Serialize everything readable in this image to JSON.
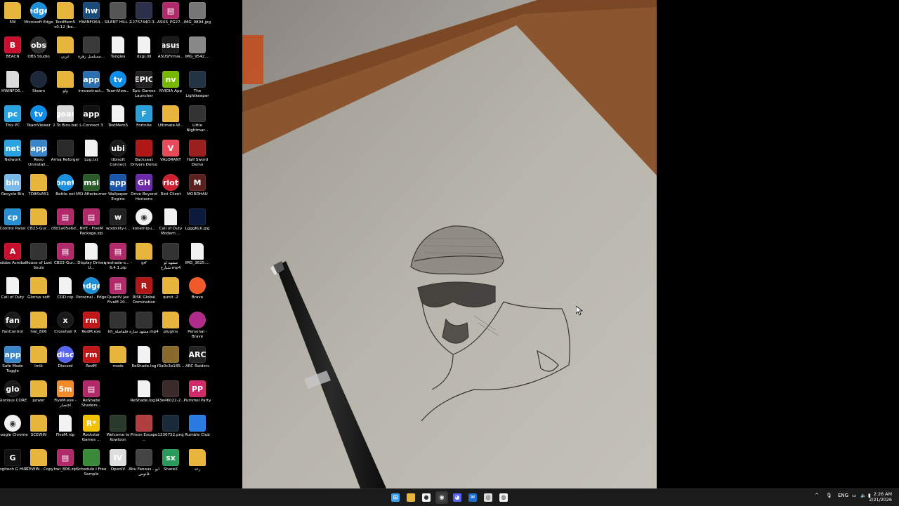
{
  "desktop": {
    "icons": [
      {
        "label": "5W",
        "color": "#e8b53c",
        "glyph": "folder"
      },
      {
        "label": "Microsoft Edge",
        "color": "#1d8fd6",
        "glyph": "edge"
      },
      {
        "label": "TestMem5 v0.12 (be...",
        "color": "#e8b53c",
        "glyph": "folder"
      },
      {
        "label": "HWiNFO64...",
        "color": "#1a4a7a",
        "glyph": "hw"
      },
      {
        "label": "SILENT HILL 2",
        "color": "#555",
        "glyph": "img"
      },
      {
        "label": "1275744D-3...",
        "color": "#2b2f4a",
        "glyph": "img"
      },
      {
        "label": "ASUS_PG27...",
        "color": "#b02a6a",
        "glyph": "rar"
      },
      {
        "label": "IMG_9894.jpg",
        "color": "#777",
        "glyph": "img"
      },
      {
        "label": "BEACN",
        "color": "#c8102e",
        "glyph": "B"
      },
      {
        "label": "OBS Studio",
        "color": "#303030",
        "glyph": "obs"
      },
      {
        "label": "عربي",
        "color": "#e8b53c",
        "glyph": "folder"
      },
      {
        "label": "مسلسل زهرة...",
        "color": "#3a3a3a",
        "glyph": "img"
      },
      {
        "label": "Tangles",
        "color": "#f2f2f2",
        "glyph": "doc"
      },
      {
        "label": "dxgi.dll",
        "color": "#f2f2f2",
        "glyph": "doc"
      },
      {
        "label": "ASUSFirmw...",
        "color": "#1a1a1a",
        "glyph": "asus"
      },
      {
        "label": "IMG_9542....",
        "color": "#888",
        "glyph": "img"
      },
      {
        "label": "HWiNFO6...",
        "color": "#dcdcdc",
        "glyph": "doc"
      },
      {
        "label": "Steam",
        "color": "#1b2838",
        "glyph": "steam"
      },
      {
        "label": "ولو",
        "color": "#e8b53c",
        "glyph": "folder"
      },
      {
        "label": "innoextract...",
        "color": "#2a6fb0",
        "glyph": "app"
      },
      {
        "label": "TeamView...",
        "color": "#0e8ee9",
        "glyph": "tv"
      },
      {
        "label": "Epic Games Launcher",
        "color": "#222",
        "glyph": "EPIC"
      },
      {
        "label": "NVIDIA App",
        "color": "#76b900",
        "glyph": "nv"
      },
      {
        "label": "The Lightkeeper",
        "color": "#234",
        "glyph": "img"
      },
      {
        "label": "This PC",
        "color": "#2aa2e0",
        "glyph": "pc"
      },
      {
        "label": "TeamViewer",
        "color": "#0e8ee9",
        "glyph": "tv"
      },
      {
        "label": "2 To Bios.bat",
        "color": "#d8d8d8",
        "glyph": "gear"
      },
      {
        "label": "L-Connect 3",
        "color": "#111",
        "glyph": "app"
      },
      {
        "label": "TestMem5",
        "color": "#f2f2f2",
        "glyph": "doc"
      },
      {
        "label": "Fortnite",
        "color": "#2a9fd8",
        "glyph": "F"
      },
      {
        "label": "Ultimate-W...",
        "color": "#e8b53c",
        "glyph": "folder"
      },
      {
        "label": "Little Nightmar...",
        "color": "#333",
        "glyph": "img"
      },
      {
        "label": "Network",
        "color": "#2aa2e0",
        "glyph": "net"
      },
      {
        "label": "Revo Uninstall...",
        "color": "#3a86c8",
        "glyph": "app"
      },
      {
        "label": "Arma Reforger",
        "color": "#2a2a2a",
        "glyph": "img"
      },
      {
        "label": "Log.txt",
        "color": "#f2f2f2",
        "glyph": "doc"
      },
      {
        "label": "Ubisoft Connect",
        "color": "#1a1a1a",
        "glyph": "ubi"
      },
      {
        "label": "Backseat Drivers Demo",
        "color": "#b01818",
        "glyph": "img"
      },
      {
        "label": "VALORANT",
        "color": "#e84a5a",
        "glyph": "V"
      },
      {
        "label": "Half Sword Demo",
        "color": "#9a2020",
        "glyph": "img"
      },
      {
        "label": "Recycle Bin",
        "color": "#7ab8e8",
        "glyph": "bin"
      },
      {
        "label": "7D86VA51",
        "color": "#e8b53c",
        "glyph": "folder"
      },
      {
        "label": "Battle.net",
        "color": "#1a8fe0",
        "glyph": "bnet"
      },
      {
        "label": "MSI Afterburner",
        "color": "#2a5a2a",
        "glyph": "msi"
      },
      {
        "label": "Wallpaper Engine",
        "color": "#1a55a8",
        "glyph": "app"
      },
      {
        "label": "Drive Beyond Horizons",
        "color": "#6a2aa8",
        "glyph": "GH"
      },
      {
        "label": "Riot Client",
        "color": "#d02030",
        "glyph": "riot"
      },
      {
        "label": "MORDHAU",
        "color": "#5a2020",
        "glyph": "M"
      },
      {
        "label": "Control Panel",
        "color": "#2a8fd0",
        "glyph": "cp"
      },
      {
        "label": "CB23-Gur...",
        "color": "#e8b53c",
        "glyph": "folder"
      },
      {
        "label": "c8d1a05e6d...",
        "color": "#b02a6a",
        "glyph": "rar"
      },
      {
        "label": "NVE - FiveM Package.zip",
        "color": "#b02a6a",
        "glyph": "rar"
      },
      {
        "label": "woobility-l...",
        "color": "#222",
        "glyph": "w"
      },
      {
        "label": "konemipu...",
        "color": "#f2f2f2",
        "glyph": "chrome"
      },
      {
        "label": "Call of Duty Modern ...",
        "color": "#f2f2f2",
        "glyph": "doc"
      },
      {
        "label": "LgggKLK.jpg",
        "color": "#0b1b3b",
        "glyph": "img"
      },
      {
        "label": "Adobe Acrobat",
        "color": "#c8102e",
        "glyph": "pdf"
      },
      {
        "label": "House of Lost Souls",
        "color": "#333",
        "glyph": "img"
      },
      {
        "label": "CB23-Gur...",
        "color": "#b02a6a",
        "glyph": "rar"
      },
      {
        "label": "Display Driver U...",
        "color": "#f2f2f2",
        "glyph": "doc"
      },
      {
        "label": "qreshade-s... - 6.4.1.zip",
        "color": "#b02a6a",
        "glyph": "rar"
      },
      {
        "label": "grf",
        "color": "#e8b53c",
        "glyph": "folder"
      },
      {
        "label": "مشهد لو شيارح.mp4",
        "color": "#333",
        "glyph": "img"
      },
      {
        "label": "IMG_3625....",
        "color": "#f2f2f2",
        "glyph": "doc"
      },
      {
        "label": "Call of Duty",
        "color": "#f2f2f2",
        "glyph": "doc"
      },
      {
        "label": "Glorius soft",
        "color": "#e8b53c",
        "glyph": "folder"
      },
      {
        "label": "COD.nip",
        "color": "#f2f2f2",
        "glyph": "doc"
      },
      {
        "label": "Personal - Edge",
        "color": "#1d8fd6",
        "glyph": "edge"
      },
      {
        "label": "QuantV jax FiveM 20...",
        "color": "#b02a6a",
        "glyph": "rar"
      },
      {
        "label": "RISK Global Domination",
        "color": "#b01818",
        "glyph": "R"
      },
      {
        "label": "qunit -2",
        "color": "#e8b53c",
        "glyph": "folder"
      },
      {
        "label": "Brave",
        "color": "#f05a28",
        "glyph": "brave"
      },
      {
        "label": "FanControl",
        "color": "#1a1a1a",
        "glyph": "fan"
      },
      {
        "label": "hwi_806",
        "color": "#e8b53c",
        "glyph": "folder"
      },
      {
        "label": "Crosshair X",
        "color": "#1a1a1a",
        "glyph": "x"
      },
      {
        "label": "RedM.exe",
        "color": "#c01818",
        "glyph": "rm"
      },
      {
        "label": "kh_فلفاضلة",
        "color": "#333",
        "glyph": "img"
      },
      {
        "label": "مشهد سارة.mp4",
        "color": "#333",
        "glyph": "img"
      },
      {
        "label": "plugins",
        "color": "#e8b53c",
        "glyph": "folder"
      },
      {
        "label": "Personal - Brave",
        "color": "#b02a8a",
        "glyph": "brave"
      },
      {
        "label": "Safe Mode Toggle",
        "color": "#3a86c8",
        "glyph": "app"
      },
      {
        "label": "lmlk",
        "color": "#e8b53c",
        "glyph": "folder"
      },
      {
        "label": "Discord",
        "color": "#5865f2",
        "glyph": "disc"
      },
      {
        "label": "RedM",
        "color": "#c01818",
        "glyph": "rm"
      },
      {
        "label": "mods",
        "color": "#e8b53c",
        "glyph": "folder"
      },
      {
        "label": "ReShade.log",
        "color": "#f2f2f2",
        "glyph": "doc"
      },
      {
        "label": "f3a0c3e185...",
        "color": "#8a6a2a",
        "glyph": "img"
      },
      {
        "label": "ARC Raiders",
        "color": "#222",
        "glyph": "ARC"
      },
      {
        "label": "Glorious CORE",
        "color": "#1a1a1a",
        "glyph": "glo"
      },
      {
        "label": "power",
        "color": "#e8b53c",
        "glyph": "folder"
      },
      {
        "label": "FiveM.exe - اختصار",
        "color": "#f08a2a",
        "glyph": "5m"
      },
      {
        "label": "ReShade Shaders...",
        "color": "#b02a6a",
        "glyph": "rar"
      },
      {
        "label": "",
        "color": "transparent",
        "glyph": ""
      },
      {
        "label": "ReShade.log1",
        "color": "#f2f2f2",
        "glyph": "doc"
      },
      {
        "label": "43e46022-2...",
        "color": "#3a2a2a",
        "glyph": "img"
      },
      {
        "label": "Pummel Party",
        "color": "#d02a6a",
        "glyph": "PP"
      },
      {
        "label": "Google Chrome",
        "color": "#f2f2f2",
        "glyph": "chrome"
      },
      {
        "label": "SCEWIN",
        "color": "#e8b53c",
        "glyph": "folder"
      },
      {
        "label": "FiveM.nip",
        "color": "#f2f2f2",
        "glyph": "doc"
      },
      {
        "label": "Rockstar Games ...",
        "color": "#f2c200",
        "glyph": "R*"
      },
      {
        "label": "Welcome to Kowloon",
        "color": "#2a3a2a",
        "glyph": "img"
      },
      {
        "label": "Prison Escape ...",
        "color": "#b04040",
        "glyph": "img"
      },
      {
        "label": "1330752.png",
        "color": "#1a2a3a",
        "glyph": "img"
      },
      {
        "label": "Rumble Club",
        "color": "#2a7ae0",
        "glyph": "img"
      },
      {
        "label": "Logitech G HUB",
        "color": "#111",
        "glyph": "G"
      },
      {
        "label": "SCEWIN - Copy",
        "color": "#e8b53c",
        "glyph": "folder"
      },
      {
        "label": "hwi_806.zip",
        "color": "#b02a6a",
        "glyph": "rar"
      },
      {
        "label": "Schedule I Free Sample",
        "color": "#3a8a3a",
        "glyph": "img"
      },
      {
        "label": "OpenIV",
        "color": "#ddd",
        "glyph": "IV"
      },
      {
        "label": "Abu Fanous - ابو فانوس",
        "color": "#444",
        "glyph": "img"
      },
      {
        "label": "ShareX",
        "color": "#2a9a5a",
        "glyph": "sx"
      },
      {
        "label": "رعد",
        "color": "#e8b53c",
        "glyph": "folder"
      }
    ]
  },
  "taskbar": {
    "apps": [
      {
        "name": "start-button",
        "color": "#3aa0f0",
        "glyph": "⊞"
      },
      {
        "name": "file-explorer",
        "color": "#e8b53c",
        "glyph": ""
      },
      {
        "name": "chrome",
        "color": "#f2f2f2",
        "glyph": "●"
      },
      {
        "name": "obs",
        "color": "#444",
        "glyph": "◉"
      },
      {
        "name": "discord",
        "color": "#5865f2",
        "glyph": "◕"
      },
      {
        "name": "outlook",
        "color": "#1a6fd0",
        "glyph": "✉"
      },
      {
        "name": "obs-2",
        "color": "#ddd",
        "glyph": "◎"
      },
      {
        "name": "paint",
        "color": "#f2f2f2",
        "glyph": "◍"
      }
    ],
    "tray": {
      "chevron": "^",
      "language": "ENG",
      "time": "2:26 AM",
      "date": "2/21/2026"
    }
  }
}
